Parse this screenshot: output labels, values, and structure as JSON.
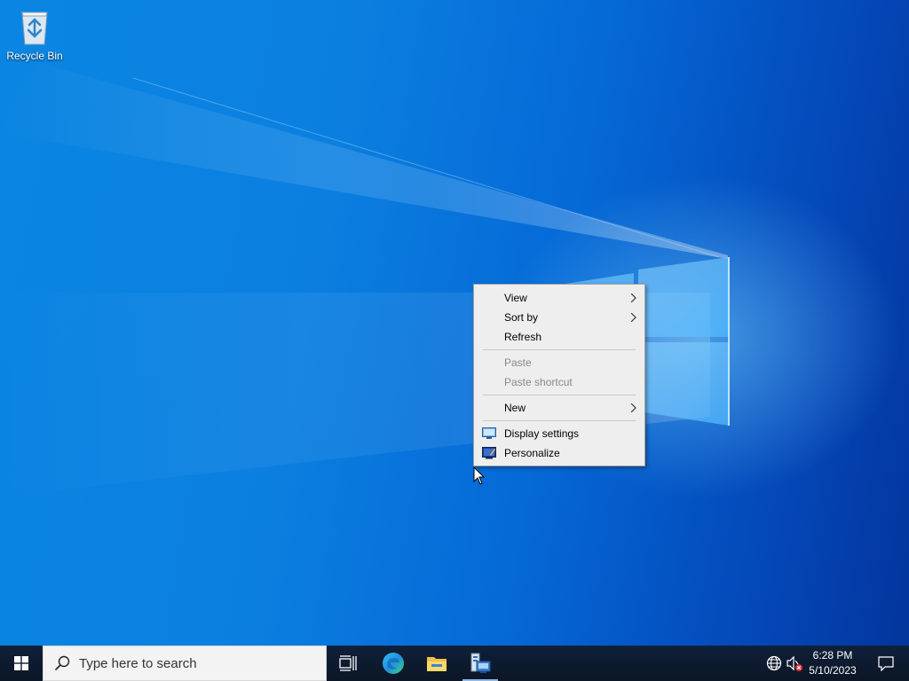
{
  "desktop": {
    "icons": [
      {
        "label": "Recycle Bin",
        "icon": "recycle-bin-icon"
      }
    ]
  },
  "context_menu": {
    "items": [
      {
        "label": "View",
        "submenu": true,
        "disabled": false
      },
      {
        "label": "Sort by",
        "submenu": true,
        "disabled": false
      },
      {
        "label": "Refresh",
        "submenu": false,
        "disabled": false
      },
      {
        "label": "Paste",
        "submenu": false,
        "disabled": true
      },
      {
        "label": "Paste shortcut",
        "submenu": false,
        "disabled": true
      },
      {
        "label": "New",
        "submenu": true,
        "disabled": false
      },
      {
        "label": "Display settings",
        "icon": "display-settings-icon",
        "disabled": false
      },
      {
        "label": "Personalize",
        "icon": "personalize-icon",
        "disabled": false
      }
    ]
  },
  "taskbar": {
    "search_placeholder": "Type here to search",
    "pinned": [
      {
        "name": "task-view",
        "icon": "task-view-icon"
      },
      {
        "name": "edge",
        "icon": "edge-icon"
      },
      {
        "name": "file-explorer",
        "icon": "folder-icon"
      },
      {
        "name": "server-manager",
        "icon": "server-manager-icon",
        "active": true
      }
    ],
    "tray": {
      "time": "6:28 PM",
      "date": "5/10/2023"
    }
  },
  "colors": {
    "desktop_blue": "#0b7fe0",
    "taskbar": "#0c1a2c",
    "menu_bg": "#eeeeee",
    "disabled_text": "#8a8a8a"
  }
}
